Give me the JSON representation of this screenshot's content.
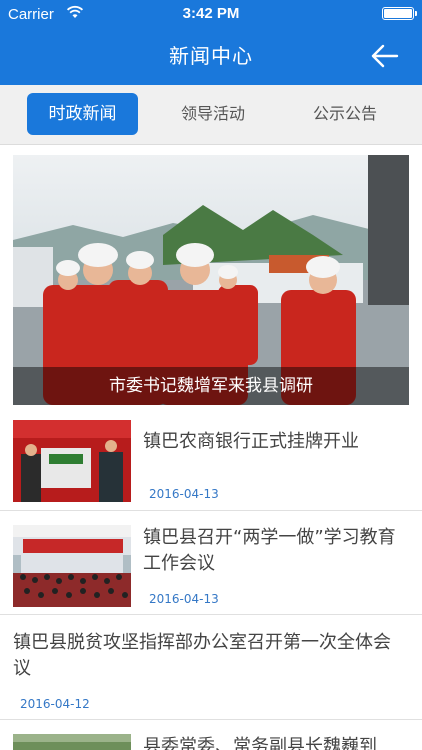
{
  "status_bar": {
    "carrier": "Carrier",
    "time": "3:42 PM"
  },
  "header": {
    "title": "新闻中心"
  },
  "tabs": [
    {
      "label": "时政新闻",
      "active": true
    },
    {
      "label": "领导活动",
      "active": false
    },
    {
      "label": "公示公告",
      "active": false
    }
  ],
  "hero": {
    "caption": "市委书记魏增军来我县调研"
  },
  "news": [
    {
      "title": "镇巴农商银行正式挂牌开业",
      "date": "2016-04-13"
    },
    {
      "title": "镇巴县召开“两学一做”学习教育工作会议",
      "date": "2016-04-13"
    },
    {
      "title": "镇巴县脱贫攻坚指挥部办公室召开第一次全体会议",
      "date": "2016-04-12"
    },
    {
      "title": "县委常委、常务副县长魏巍到"
    }
  ],
  "colors": {
    "brand_blue": "#1a78db",
    "date_blue": "#3578c6"
  }
}
